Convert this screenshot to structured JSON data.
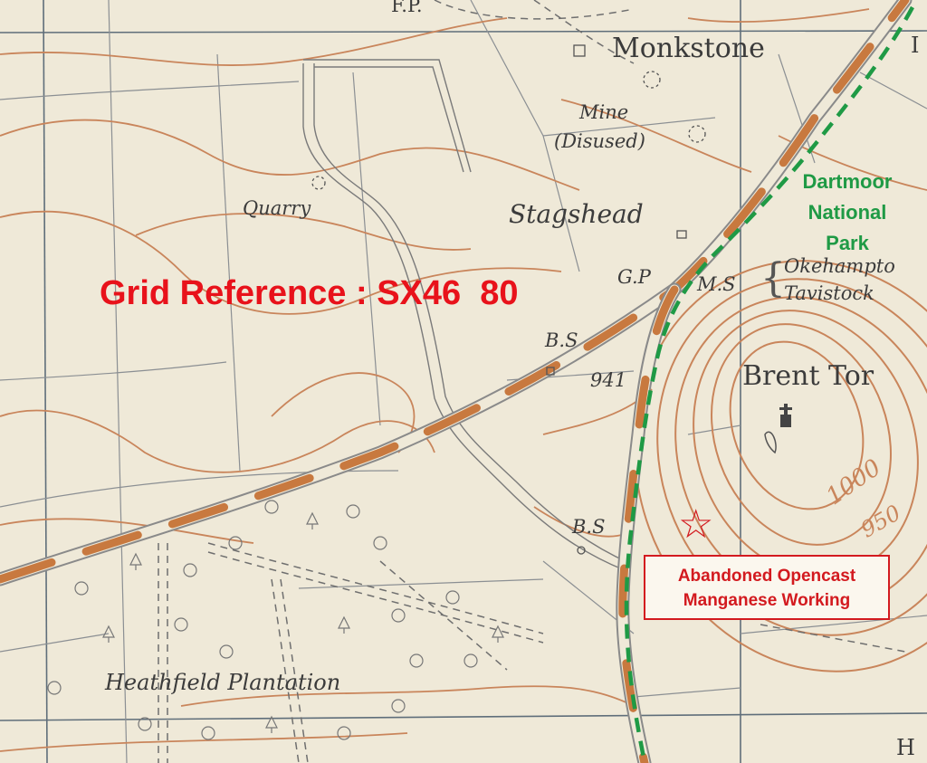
{
  "map": {
    "place_names": {
      "monkstone": "Monkstone",
      "mine": "Mine",
      "disused": "(Disused)",
      "quarry": "Quarry",
      "stagshead": "Stagshead",
      "brent_tor": "Brent Tor",
      "heathfield": "Heathfield Plantation"
    },
    "abbreviations": {
      "fp": "F.P.",
      "gp": "G.P",
      "ms": "M.S",
      "bs_upper": "B.S",
      "bs_lower": "B.S"
    },
    "milestone_destinations": [
      "Okehampto",
      "Tavistock"
    ],
    "spot_height": "941",
    "contour_labels": [
      "1000",
      "950"
    ],
    "edge_fragments": {
      "top_right": "I",
      "bottom_right": "H"
    },
    "colors": {
      "paper": "#efe9d8",
      "contour": "#c9855b",
      "road_casing": "#8a8a8a",
      "road_fill": "#c8793f",
      "boundary": "#1f9a45",
      "annotation_red": "#d31a1f",
      "grid_ref_red": "#e8121b",
      "ink": "#3b3b3b"
    }
  },
  "annotations": {
    "grid_reference": "Grid Reference : SX46  80",
    "national_park": [
      "Dartmoor",
      "National",
      "Park"
    ],
    "site_marker_icon": "star-icon",
    "site_label": [
      "Abandoned Opencast",
      "Manganese Working"
    ]
  }
}
